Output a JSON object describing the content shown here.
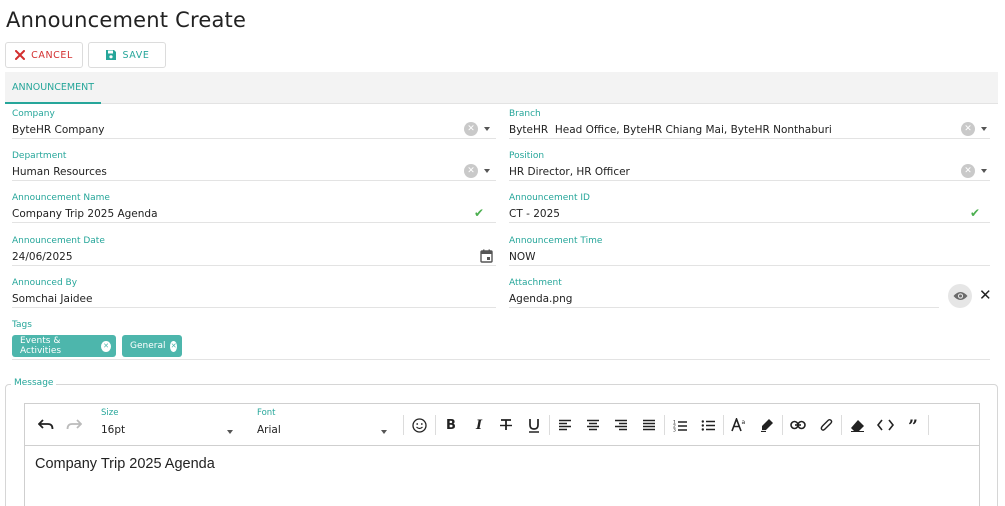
{
  "page": {
    "title": "Announcement Create"
  },
  "toolbar": {
    "cancel_label": "CANCEL",
    "save_label": "SAVE"
  },
  "tabs": [
    {
      "label": "ANNOUNCEMENT",
      "active": true
    }
  ],
  "form": {
    "company": {
      "label": "Company",
      "value": "ByteHR Company"
    },
    "branch": {
      "label": "Branch",
      "value": "ByteHR  Head Office, ByteHR Chiang Mai, ByteHR Nonthaburi"
    },
    "department": {
      "label": "Department",
      "value": "Human Resources"
    },
    "position": {
      "label": "Position",
      "value": "HR Director, HR Officer"
    },
    "announcement_name": {
      "label": "Announcement Name",
      "value": "Company Trip 2025 Agenda"
    },
    "announcement_id": {
      "label": "Announcement ID",
      "value": "CT - 2025"
    },
    "announcement_date": {
      "label": "Announcement Date",
      "value": "24/06/2025"
    },
    "announcement_time": {
      "label": "Announcement Time",
      "value": "NOW"
    },
    "announced_by": {
      "label": "Announced By",
      "value": "Somchai Jaidee"
    },
    "attachment": {
      "label": "Attachment",
      "value": "Agenda.png"
    },
    "tags": {
      "label": "Tags",
      "items": [
        "Events & Activities",
        "General"
      ]
    }
  },
  "message": {
    "legend": "Message",
    "size": {
      "label": "Size",
      "value": "16pt"
    },
    "font": {
      "label": "Font",
      "value": "Arial"
    },
    "content": "Company Trip 2025 Agenda"
  },
  "colors": {
    "accent": "#26a69a",
    "cancel": "#d32f2f",
    "chip": "#4db6ac",
    "valid": "#4caf50"
  }
}
